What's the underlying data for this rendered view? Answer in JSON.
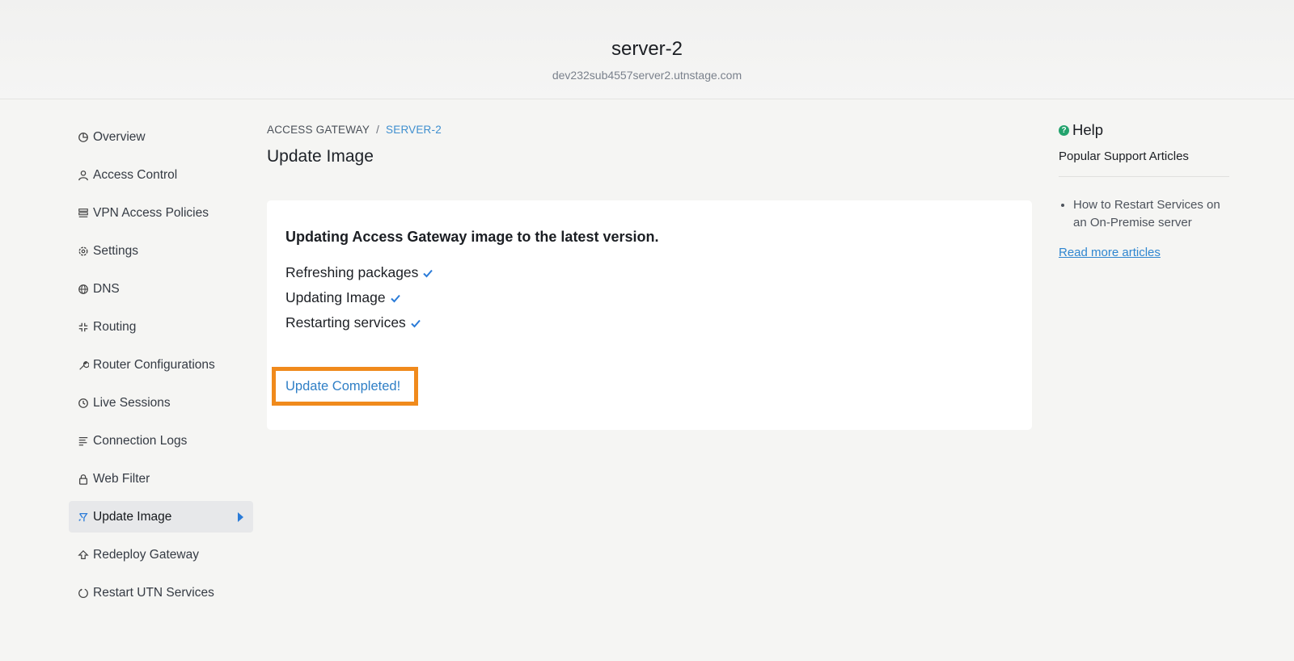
{
  "header": {
    "title": "server-2",
    "subtitle": "dev232sub4557server2.utnstage.com"
  },
  "sidebar": {
    "items": [
      {
        "label": "Overview",
        "icon": "pie-chart-icon"
      },
      {
        "label": "Access Control",
        "icon": "user-icon"
      },
      {
        "label": "VPN Access Policies",
        "icon": "list-icon"
      },
      {
        "label": "Settings",
        "icon": "gear-icon"
      },
      {
        "label": "DNS",
        "icon": "globe-icon"
      },
      {
        "label": "Routing",
        "icon": "routing-icon"
      },
      {
        "label": "Router Configurations",
        "icon": "wrench-icon"
      },
      {
        "label": "Live Sessions",
        "icon": "clock-icon"
      },
      {
        "label": "Connection Logs",
        "icon": "lines-icon"
      },
      {
        "label": "Web Filter",
        "icon": "lock-icon"
      },
      {
        "label": "Update Image",
        "icon": "update-icon",
        "active": true
      },
      {
        "label": "Redeploy Gateway",
        "icon": "redeploy-icon"
      },
      {
        "label": "Restart UTN Services",
        "icon": "restart-icon"
      }
    ]
  },
  "breadcrumb": {
    "parent": "ACCESS GATEWAY",
    "separator": "/",
    "current": "SERVER-2"
  },
  "main": {
    "title": "Update Image",
    "card": {
      "heading": "Updating Access Gateway image to the latest version.",
      "steps": [
        "Refreshing packages",
        "Updating Image",
        "Restarting services"
      ],
      "status": "Update Completed!"
    }
  },
  "help": {
    "title": "Help",
    "subtitle": "Popular Support Articles",
    "articles": [
      "How to Restart Services on an On-Premise server"
    ],
    "read_more": "Read more articles"
  },
  "colors": {
    "accent": "#2a7bd8",
    "highlight": "#f08a1c",
    "check": "#2a7bd8",
    "help_icon": "#23a36d"
  }
}
